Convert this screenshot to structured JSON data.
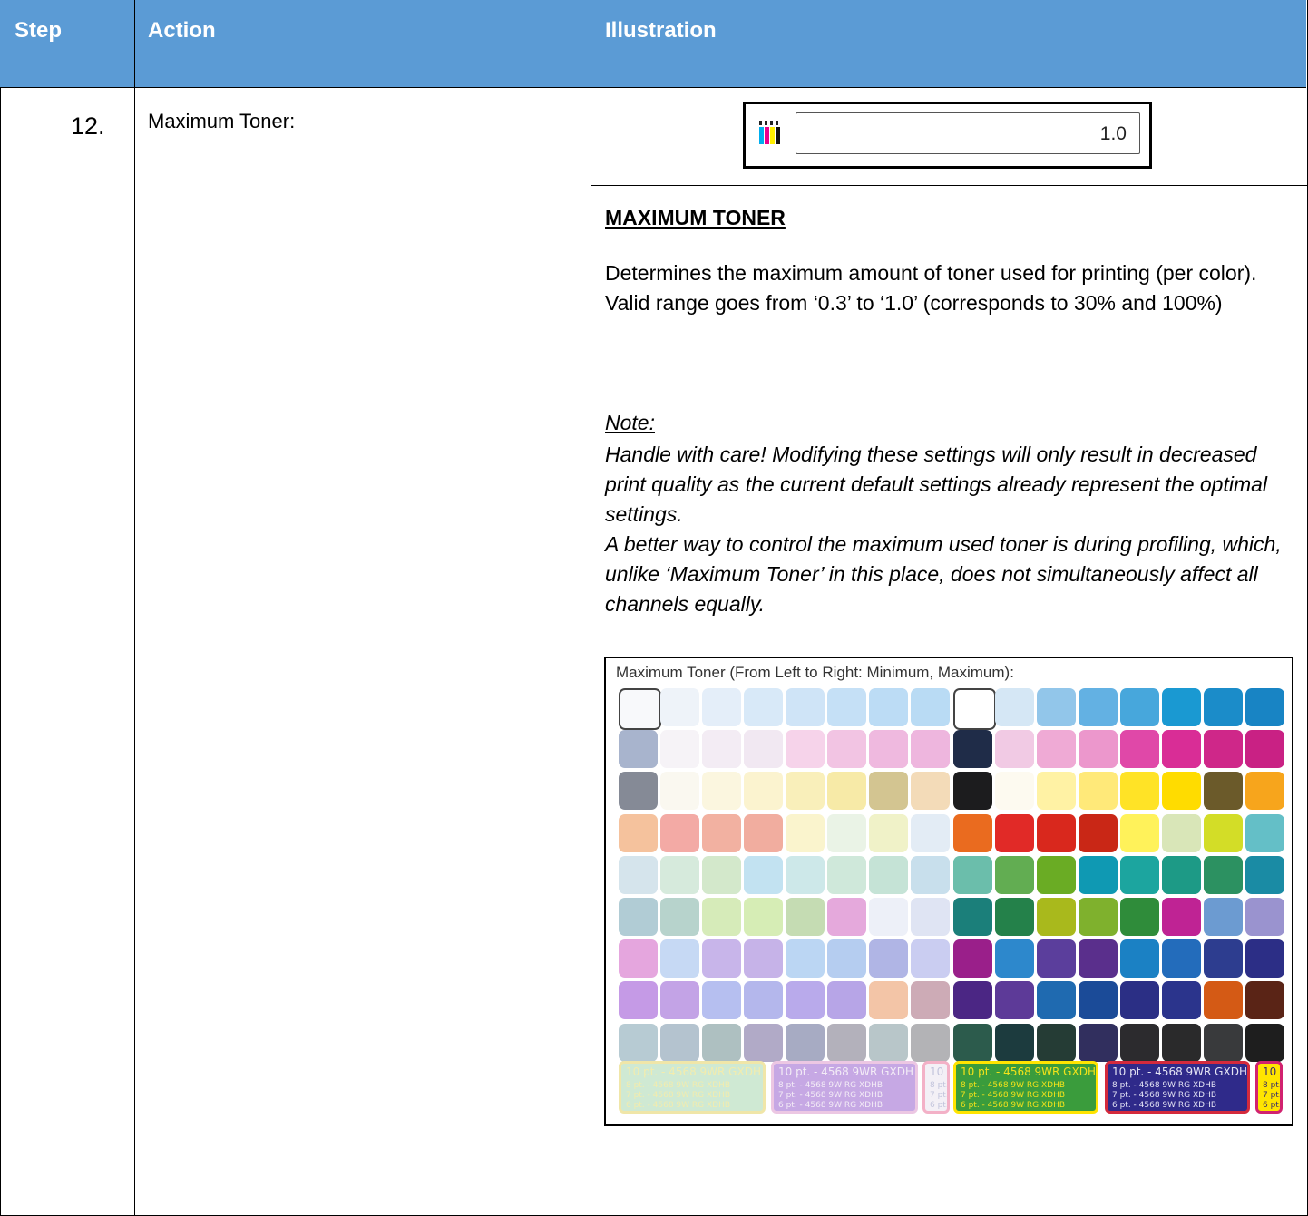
{
  "header": {
    "step": "Step",
    "action": "Action",
    "illustration": "Illustration"
  },
  "row": {
    "step_number": "12.",
    "action_text": "Maximum Toner:",
    "field": {
      "icon": "cmyk-toner-icon",
      "value": "1.0"
    },
    "section_title": "MAXIMUM TONER",
    "description": "Determines the maximum amount of toner used for printing (per color).\nValid range goes from ‘0.3’ to ‘1.0’ (corresponds to 30% and 100%)",
    "note_label": "Note:",
    "note_text": "Handle with care! Modifying these settings will only result in decreased print quality as the current default settings already represent the optimal settings.\nA better way to control the maximum used toner is during profiling, which, unlike ‘Maximum Toner’ in this place, does not simultaneously affect all channels equally."
  },
  "chart": {
    "title": "Maximum Toner (From Left to Right: Minimum, Maximum):",
    "left_grid": [
      [
        "#f8f9fb",
        "#eef3f9",
        "#e4eef9",
        "#d8e9f8",
        "#cfe4f7",
        "#c5e0f6",
        "#bcdcf5",
        "#b9dbf4"
      ],
      [
        "#a8b4cd",
        "#f6f3f7",
        "#f3ecf4",
        "#f1e8f2",
        "#f6d3ea",
        "#f2c4e3",
        "#efb9df",
        "#eeb6de"
      ],
      [
        "#858a96",
        "#faf8f0",
        "#fbf6df",
        "#fbf3cf",
        "#f9efba",
        "#f7eaa7",
        "#d3c591",
        "#f3dbb8"
      ],
      [
        "#f5c29d",
        "#f3aaa5",
        "#f2b1a1",
        "#f1ad9f",
        "#faf4cd",
        "#eaf3e6",
        "#f0f2c8",
        "#e3ecf5"
      ],
      [
        "#d5e4ec",
        "#d6eadc",
        "#d3e8cb",
        "#c2e2f1",
        "#cde8e9",
        "#cfe8da",
        "#c5e3d6",
        "#c8dfec"
      ],
      [
        "#b1ccd5",
        "#b7d3cc",
        "#d6ebb9",
        "#d6edb5",
        "#c5dcb3",
        "#e5a9dc",
        "#edf0f8",
        "#dfe4f3"
      ],
      [
        "#e5a6de",
        "#c6d9f4",
        "#c8b5ea",
        "#c6b3e8",
        "#bbd6f3",
        "#b5cdf0",
        "#b0b5e5",
        "#cacdf1"
      ],
      [
        "#c59ae6",
        "#c3a3e6",
        "#b6bff0",
        "#b4b7ec",
        "#b9aaeb",
        "#b7a5e7",
        "#f3c5a7",
        "#cdabb6"
      ],
      [
        "#b7cbd3",
        "#b4c3cf",
        "#aec0c1",
        "#b1aac7",
        "#a7abc3",
        "#b3b1bb",
        "#b8c6c9",
        "#b3b3b6"
      ]
    ],
    "right_grid": [
      [
        "#ffffff",
        "#d5e7f5",
        "#92c6ea",
        "#63b1e3",
        "#47a7dc",
        "#1a99d2",
        "#1b8cc9",
        "#1884c4"
      ],
      [
        "#1f2c48",
        "#f1cae4",
        "#efaad5",
        "#ec97cc",
        "#e048a8",
        "#d92d96",
        "#cf2789",
        "#c92184"
      ],
      [
        "#1c1c1e",
        "#fdfaf0",
        "#fff2a4",
        "#ffe979",
        "#ffe326",
        "#ffdc00",
        "#6b5a2a",
        "#f7a51c"
      ],
      [
        "#ea6b1f",
        "#e12a27",
        "#d9281d",
        "#c92716",
        "#fff25a",
        "#d9e6b8",
        "#d3dd27",
        "#64bfc7"
      ],
      [
        "#6bbeab",
        "#62ad52",
        "#6aac24",
        "#0f99b3",
        "#1ca59f",
        "#1d9a86",
        "#2c9161",
        "#1a8ba4"
      ],
      [
        "#1b7f7a",
        "#24814a",
        "#a9b91c",
        "#7fb12d",
        "#2f8c3a",
        "#bf2394",
        "#6c9bd1",
        "#9a93cf"
      ],
      [
        "#9a1f8a",
        "#2d88cc",
        "#5b3e9c",
        "#5a2f8c",
        "#1b81c4",
        "#236cbb",
        "#2d3d8f",
        "#2c2e86"
      ],
      [
        "#4b2684",
        "#5d3a98",
        "#1f6ab0",
        "#1b4b98",
        "#2b2f85",
        "#2b348c",
        "#d45a15",
        "#5a2416"
      ],
      [
        "#2c5b4c",
        "#1c3b3e",
        "#253c35",
        "#312f5e",
        "#2c2b2e",
        "#2a2a2b",
        "#393a3c",
        "#1e1e1e"
      ]
    ],
    "labels": [
      {
        "fill": "#cfe9d3",
        "stroke": "#f0e6a8",
        "text_color": "#f2ecae",
        "lines": [
          "10 pt. - 4568 9WR GXDH B",
          "8 pt. - 4568 9W RG XDHB",
          "7 pt. - 4568 9W RG XDHB",
          "6 pt. - 4568 9W RG XDHB"
        ]
      },
      {
        "fill": "#c6a8e4",
        "stroke": "#ecc7e3",
        "text_color": "#f3ecf6",
        "lines": [
          "10 pt. - 4568 9WR GXDH B",
          "8 pt. - 4568 9W RG XDHB",
          "7 pt. - 4568 9W RG XDHB",
          "6 pt. - 4568 9W RG XDHB"
        ]
      },
      {
        "fill": "#f3f0f6",
        "stroke": "#f3b1c7",
        "text_color": "#c2c4dc",
        "lines": [
          "10 p",
          "8 pt.",
          "7 pt.",
          "6 pt."
        ]
      },
      {
        "fill": "#3a9c3c",
        "stroke": "#ffe400",
        "text_color": "#f2e21a",
        "lines": [
          "10 pt. - 4568 9WR GXDH B",
          "8 pt. - 4568 9W RG XDHB",
          "7 pt. - 4568 9W RG XDHB",
          "6 pt. - 4568 9W RG XDHB"
        ]
      },
      {
        "fill": "#2f2a8a",
        "stroke": "#d42a3c",
        "text_color": "#e4e4f4",
        "lines": [
          "10 pt. - 4568 9WR GXDH B",
          "8 pt. - 4568 9W RG XDHB",
          "7 pt. - 4568 9W RG XDHB",
          "6 pt. - 4568 9W RG XDHB"
        ]
      },
      {
        "fill": "#ffe500",
        "stroke": "#d1226f",
        "text_color": "#3a2d6a",
        "lines": [
          "10 p",
          "8 pt.",
          "7 pt.",
          "6 pt."
        ]
      }
    ]
  }
}
